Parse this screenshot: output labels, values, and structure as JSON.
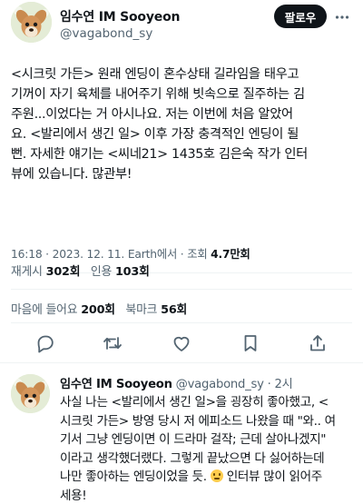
{
  "author": {
    "name": "임수연 IM Sooyeon",
    "handle": "@vagabond_sy"
  },
  "follow_label": "팔로우",
  "more_icon": "ellipsis-icon",
  "tweet": {
    "lines": [
      "<시크릿 가든> 원래 엔딩이 혼수상태 길라임을 태우고",
      "기꺼이 자기 육체를 내어주기 위해 빗속으로 질주하는 김",
      "주원...이었다는 거 아시나요. 저는 이번에 처음 알았어",
      "요. <발리에서 생긴 일> 이후 가장 충격적인 엔딩이 될",
      "뻔. 자세한 얘기는 <씨네21> 1435호 김은숙 작가 인터",
      "뷰에 있습니다. 많관부!"
    ]
  },
  "meta": {
    "time": "16:18",
    "date": "2023. 12. 11.",
    "location": "Earth에서",
    "views_label": "조회",
    "views": "4.7만회"
  },
  "stats": {
    "retweets_label": "재게시",
    "retweets": "302회",
    "quotes_label": "인용",
    "quotes": "103회",
    "likes_label": "마음에 들어요",
    "likes": "200회",
    "bookmarks_label": "북마크",
    "bookmarks": "56회"
  },
  "actions": [
    "reply-icon",
    "retweet-icon",
    "like-icon",
    "bookmark-icon",
    "share-icon"
  ],
  "reply": {
    "name": "임수연 IM Sooyeon",
    "handle": "@vagabond_sy",
    "time": "· 2시",
    "lines": [
      "사실 나는 <발리에서 생긴 일>을 굉장히 좋아했고, <",
      "시크릿 가든> 방영 당시 저 에피소드 나왔을 때 \"와.. 여",
      "기서 그냥 엔딩이면 이 드라마 걸작; 근데 살아나겠지\"",
      "이라고 생각했더랬다. 그렇게 끝났으면 다 싫어하는데",
      "나만 좋아하는 엔딩이었을 듯.",
      "인터뷰 많이 읽어주",
      "세용!"
    ],
    "emoji": "smiling-face-emoji"
  },
  "colors": {
    "text": "#0f1419",
    "secondary": "#536471",
    "divider": "#eff3f4",
    "follow_bg": "#0f1419"
  }
}
